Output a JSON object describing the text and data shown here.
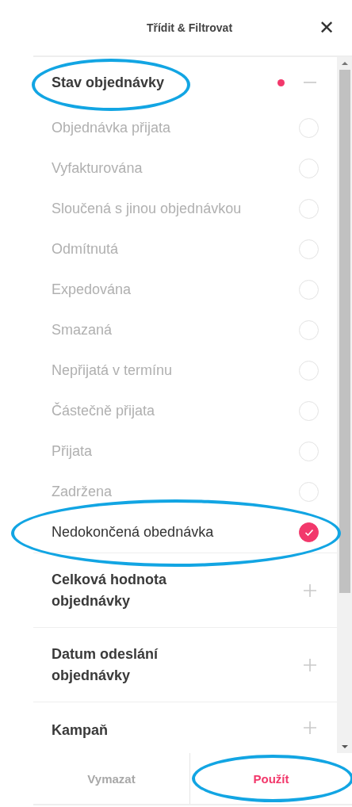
{
  "header": {
    "title": "Třídit & Filtrovat",
    "close": "✕"
  },
  "sections": [
    {
      "title": "Stav objednávky",
      "expanded": true,
      "has_active": true,
      "annotated": true,
      "options": [
        {
          "label": "Objednávka přijata",
          "checked": false,
          "annotated": false
        },
        {
          "label": "Vyfakturována",
          "checked": false,
          "annotated": false
        },
        {
          "label": "Sloučená s jinou objednávkou",
          "checked": false,
          "annotated": false
        },
        {
          "label": "Odmítnutá",
          "checked": false,
          "annotated": false
        },
        {
          "label": "Expedována",
          "checked": false,
          "annotated": false
        },
        {
          "label": "Smazaná",
          "checked": false,
          "annotated": false
        },
        {
          "label": "Nepřijatá v termínu",
          "checked": false,
          "annotated": false
        },
        {
          "label": "Částečně přijata",
          "checked": false,
          "annotated": false
        },
        {
          "label": "Přijata",
          "checked": false,
          "annotated": false
        },
        {
          "label": "Zadržena",
          "checked": false,
          "annotated": false
        },
        {
          "label": "Nedokončená obednávka",
          "checked": true,
          "annotated": true
        }
      ]
    },
    {
      "title": "Celková hodnota objednávky",
      "expanded": false,
      "has_active": false,
      "annotated": false
    },
    {
      "title": "Datum odeslání objednávky",
      "expanded": false,
      "has_active": false,
      "annotated": false
    },
    {
      "title": "Kampaň",
      "expanded": false,
      "has_active": false,
      "annotated": false
    }
  ],
  "footer": {
    "clear": {
      "label": "Vymazat",
      "annotated": false
    },
    "apply": {
      "label": "Použít",
      "annotated": true
    }
  }
}
